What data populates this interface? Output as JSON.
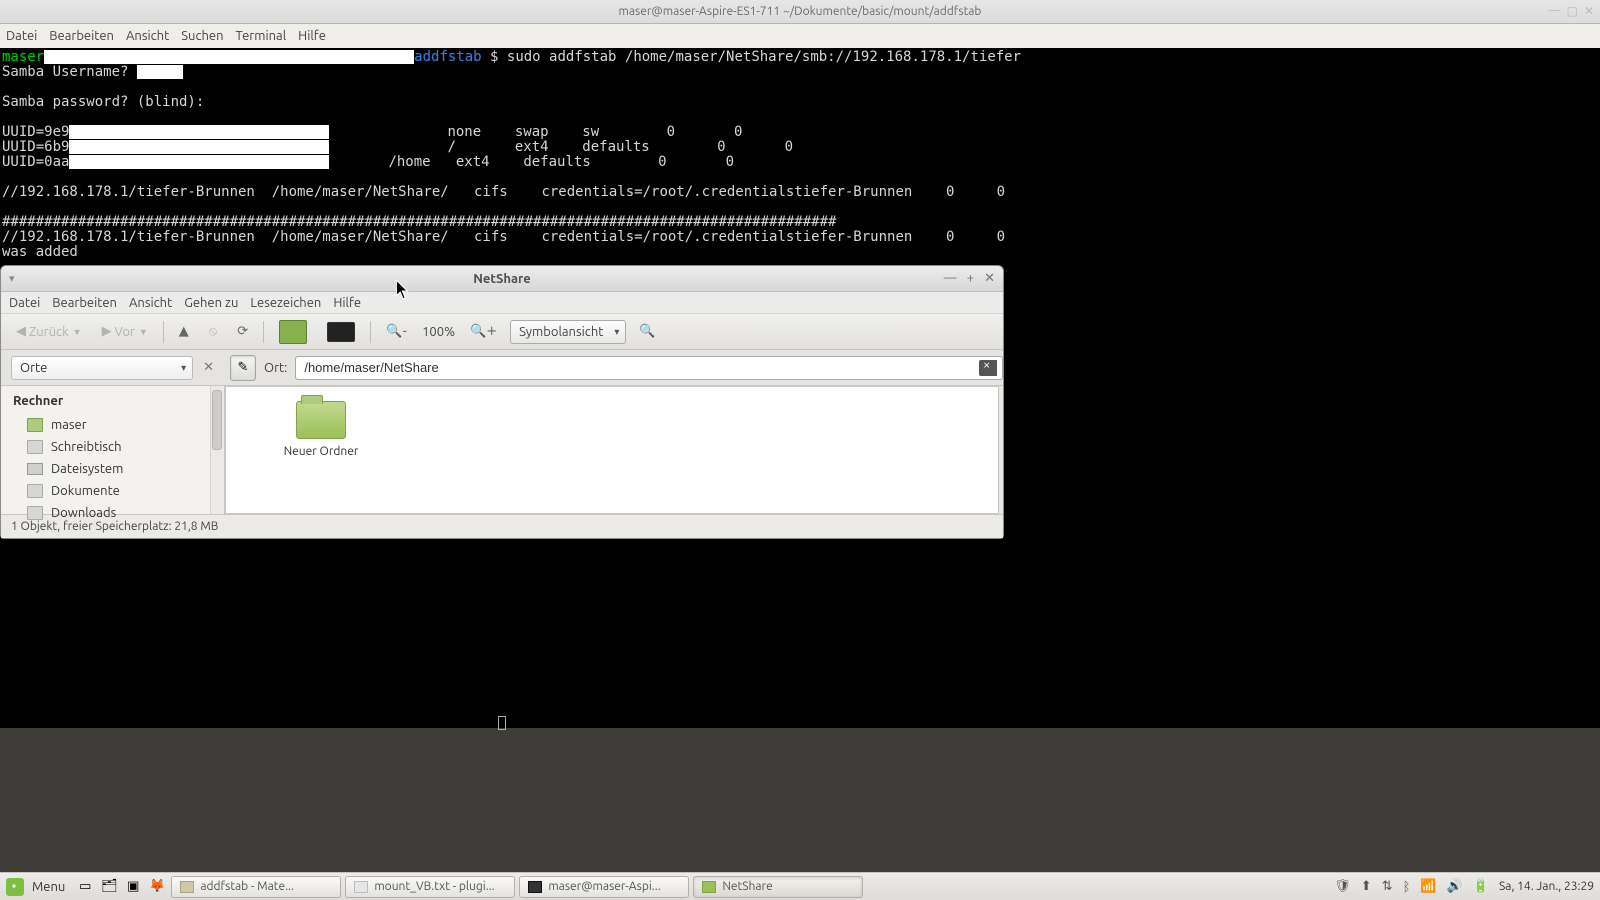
{
  "terminal": {
    "title": "maser@maser-Aspire-ES1-711 ~/Dokumente/basic/mount/addfstab",
    "menu": [
      "Datei",
      "Bearbeiten",
      "Ansicht",
      "Suchen",
      "Terminal",
      "Hilfe"
    ],
    "prompt_user": "maser",
    "prompt_dir": "addfstab",
    "prompt_dollar": " $ ",
    "cmd": "sudo addfstab /home/maser/NetShare/smb://192.168.178.1/tiefer",
    "l_samba_user": "Samba Username?",
    "l_samba_pass": "Samba password? (blind):",
    "uuid1": "UUID=9e9",
    "uuid2": "UUID=6b9",
    "uuid3": "UUID=0aa",
    "row1": "              none    swap    sw        0       0",
    "row2": "              /       ext4    defaults        0       0",
    "row3": "/home   ext4    defaults        0       0",
    "cifs_a": "//192.168.178.1/tiefer-Brunnen  /home/maser/NetShare/   cifs    credentials=/root/.credentialstiefer-Brunnen    0     0",
    "hashes": "###################################################################################################",
    "cifs_b": "//192.168.178.1/tiefer-Brunnen  /home/maser/NetShare/   cifs    credentials=/root/.credentialstiefer-Brunnen    0     0",
    "added": "was added"
  },
  "fm": {
    "title": "NetShare",
    "menu": [
      "Datei",
      "Bearbeiten",
      "Ansicht",
      "Gehen zu",
      "Lesezeichen",
      "Hilfe"
    ],
    "toolbar": {
      "back": "Zurück",
      "forward": "Vor",
      "zoom": "100%",
      "view_mode": "Symbolansicht"
    },
    "location": {
      "panel_label": "Orte",
      "ort_label": "Ort:",
      "path": "/home/maser/NetShare"
    },
    "sidebar": {
      "header": "Rechner",
      "items": [
        "maser",
        "Schreibtisch",
        "Dateisystem",
        "Dokumente",
        "Downloads"
      ]
    },
    "content": {
      "folder": "Neuer Ordner"
    },
    "status": "1 Objekt, freier Speicherplatz: 21,8 MB"
  },
  "panel": {
    "menu": "Menu",
    "tasks": [
      "addfstab - Mate...",
      "mount_VB.txt - plugi...",
      "maser@maser-Aspi...",
      "NetShare"
    ],
    "clock": "Sa, 14. Jan.,  23:29"
  }
}
